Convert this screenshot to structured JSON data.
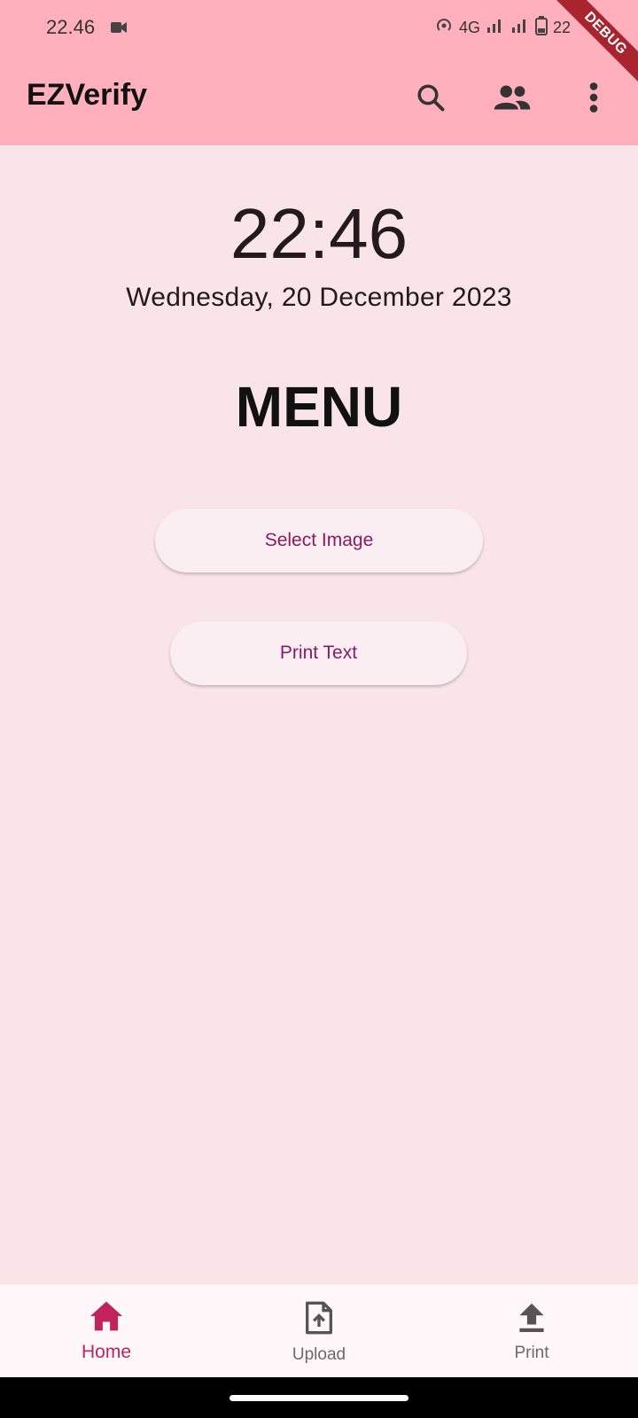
{
  "status_bar": {
    "time": "22.46",
    "network": "4G",
    "battery": "22"
  },
  "debug_ribbon": "DEBUG",
  "app_bar": {
    "title": "EZVerify",
    "actions": {
      "search_icon": "search-icon",
      "people_icon": "people-icon",
      "more_icon": "more-vert-icon"
    }
  },
  "main": {
    "clock": "22:46",
    "date": "Wednesday, 20 December 2023",
    "menu_title": "MENU",
    "buttons": {
      "select_image": "Select Image",
      "print_text": "Print Text"
    }
  },
  "bottom_nav": {
    "items": [
      {
        "label": "Home",
        "icon": "home-icon",
        "active": true
      },
      {
        "label": "Upload",
        "icon": "upload-file-icon",
        "active": false
      },
      {
        "label": "Print",
        "icon": "upload-arrow-icon",
        "active": false
      }
    ]
  },
  "colors": {
    "app_bar": "#ffb0bc",
    "background": "#f9e4ea",
    "accent": "#c0245a",
    "button_text": "#8a1b5c"
  }
}
